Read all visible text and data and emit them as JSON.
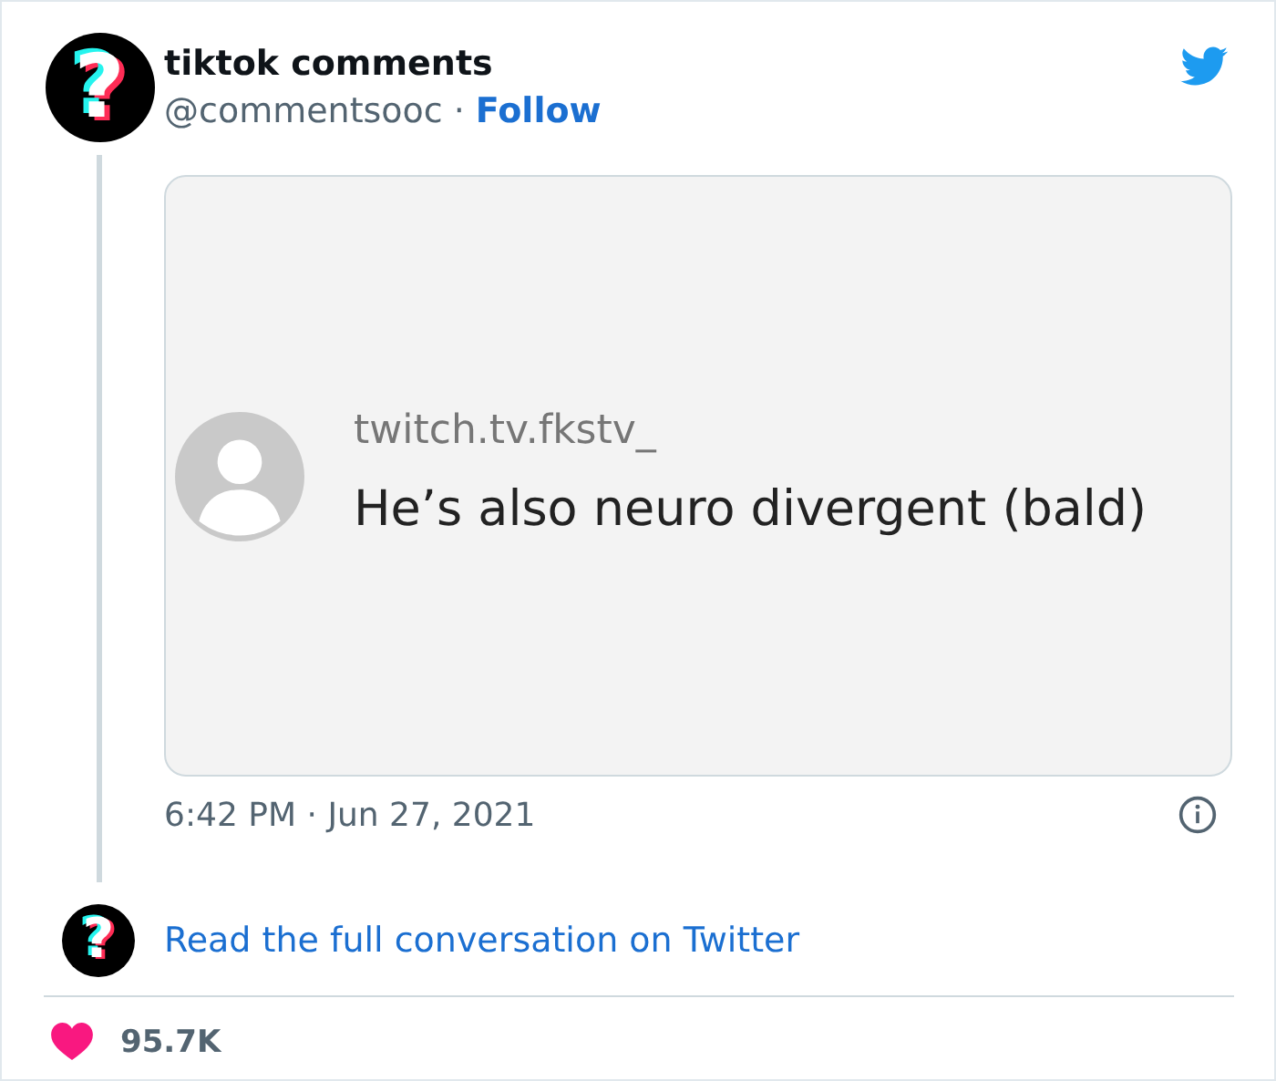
{
  "tweet": {
    "author": {
      "avatar_glyph": "?",
      "name": "tiktok comments",
      "handle": "@commentsooc",
      "separator": "·",
      "follow": "Follow"
    },
    "media": {
      "username": "twitch.tv.fkstv_",
      "comment": "He’s also neuro divergent (bald)"
    },
    "timestamp": "6:42 PM · Jun 27, 2021",
    "conversation": {
      "avatar_glyph": "?",
      "link": "Read the full conversation on Twitter"
    },
    "likes": "95.7K"
  }
}
